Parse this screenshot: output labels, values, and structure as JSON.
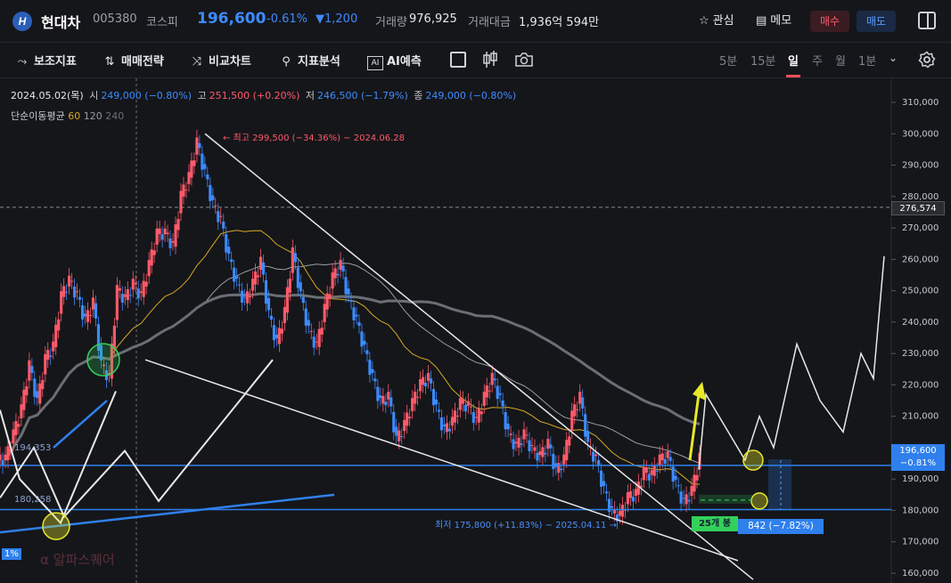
{
  "header": {
    "logo_text": "H",
    "name": "현대차",
    "code": "005380",
    "market": "코스피",
    "price": "196,600",
    "change_pct": "-0.61%",
    "change_diff": "▼1,200",
    "volume_label": "거래량",
    "volume": "976,925",
    "amount_label": "거래대금",
    "amount": "1,936억 594만",
    "favorite_label": "관심",
    "memo_label": "메모",
    "buy_label": "매수",
    "sell_label": "매도"
  },
  "toolbar": {
    "indicators_label": "보조지표",
    "strategy_label": "매매전략",
    "compare_label": "비교차트",
    "analysis_label": "지표분석",
    "ai_label": "AI예측",
    "periods": [
      "5분",
      "15분",
      "일",
      "주",
      "월",
      "1분"
    ],
    "active_period": "일"
  },
  "ohlc": {
    "date": "2024.05.02(목)",
    "open_label": "시",
    "open": "249,000 (−0.80%)",
    "high_label": "고",
    "high": "251,500 (+0.20%)",
    "low_label": "저",
    "low": "246,500 (−1.79%)",
    "close_label": "종",
    "close": "249,000 (−0.80%)"
  },
  "ma_legend": {
    "label": "단순이동평균",
    "p60": "60",
    "p120": "120",
    "p240": "240"
  },
  "annotations": {
    "high_note": "← 최고 299,500 (−34.36%) − 2024.06.28",
    "low_note": "최저 175,800 (+11.83%) − 2025.04.11 →",
    "level_upper": "194,353",
    "level_lower": "180,258",
    "watermark": "α 알파스퀘어",
    "left_pct": "1%",
    "box_25": "25개 봉",
    "box_neg": "842 (−7.82%)",
    "ref_price": "276,574",
    "cur_price": "196,600",
    "cur_pct": "−0.81%"
  },
  "colors": {
    "up": "#ff5a6a",
    "down": "#3d8bff",
    "ma60": "#d6a825",
    "ma120": "#9a9da3",
    "ma240": "#6b6e74",
    "level_line": "#2f80ed",
    "highlight_yellow": "#e8e82a",
    "highlight_green": "#33d15a"
  },
  "chart_data": {
    "type": "candlestick",
    "ylim": [
      158000,
      315000
    ],
    "y_ticks": [
      "310,000",
      "300,000",
      "290,000",
      "280,000",
      "270,000",
      "260,000",
      "250,000",
      "240,000",
      "230,000",
      "220,000",
      "210,000",
      "200,000",
      "190,000",
      "180,000",
      "170,000",
      "160,000"
    ],
    "ma_periods": [
      60,
      120,
      240
    ],
    "horizontal_levels": [
      194353,
      180258
    ],
    "reference_level": 276574,
    "current_price": 196600,
    "period_high": 299500,
    "period_high_date": "2024.06.28",
    "period_low": 175800,
    "period_low_date": "2025.04.11",
    "close_path": [
      196000,
      204000,
      212000,
      226000,
      214000,
      228000,
      232000,
      248000,
      253000,
      248000,
      240000,
      246000,
      226000,
      222000,
      250000,
      247000,
      252000,
      248000,
      258000,
      268000,
      268000,
      264000,
      280000,
      286000,
      297000,
      287000,
      277000,
      272000,
      260000,
      252000,
      246000,
      252000,
      259000,
      242000,
      233000,
      243000,
      262000,
      248000,
      237000,
      232000,
      244000,
      254000,
      258000,
      247000,
      240000,
      231000,
      222000,
      214000,
      216000,
      202000,
      207000,
      214000,
      220000,
      222000,
      212000,
      205000,
      208000,
      214000,
      213000,
      208000,
      216000,
      222000,
      215000,
      204000,
      200000,
      204000,
      199000,
      197000,
      201000,
      192000,
      196000,
      210000,
      216000,
      200000,
      196000,
      186000,
      179000,
      178000,
      184000,
      185000,
      192000,
      191000,
      196000,
      197000,
      188000,
      182000,
      186000,
      196600
    ]
  }
}
